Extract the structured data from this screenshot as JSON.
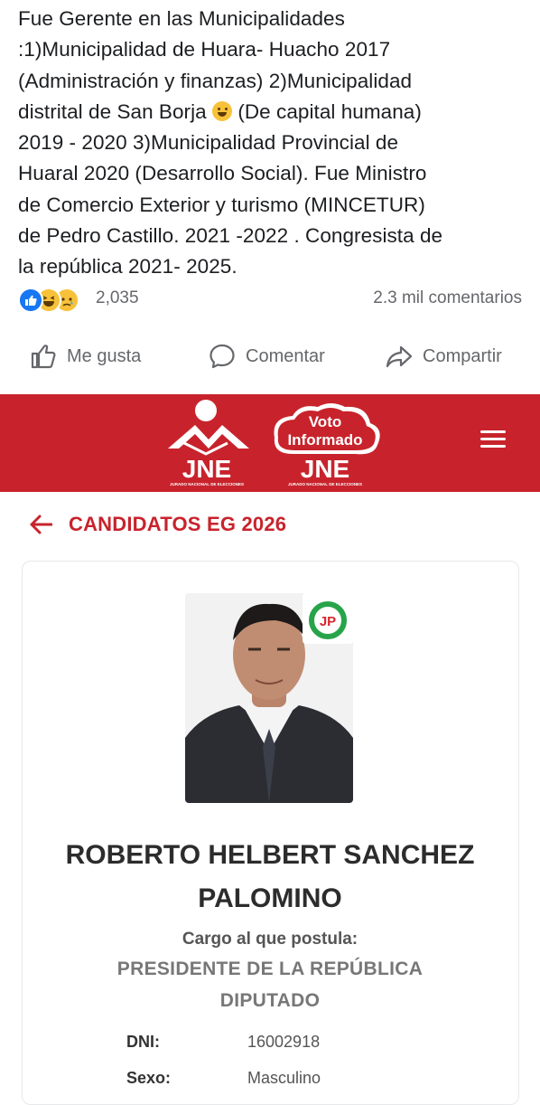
{
  "post": {
    "lines": [
      "Fue Gerente en las Municipalidades",
      ":1)Municipalidad de Huara- Huacho 2017",
      "(Administración y finanzas)  2)Municipalidad",
      "distrital de San Borja",
      " (De capital humana)",
      "2019 - 2020 3)Municipalidad Provincial de",
      "Huaral 2020 (Desarrollo Social). Fue Ministro",
      "de Comercio Exterior   y turismo (MINCETUR)",
      "de Pedro Castillo. 2021 -2022 . Congresista de",
      "la república 2021- 2025."
    ]
  },
  "reactions": {
    "count": "2,035",
    "comments": "2.3 mil comentarios",
    "icons": [
      "like-reaction",
      "haha-reaction",
      "sad-reaction"
    ]
  },
  "actions": {
    "like": "Me gusta",
    "comment": "Comentar",
    "share": "Compartir"
  },
  "jne": {
    "logo_text": "JNE",
    "logo_subtext": "JURADO NACIONAL DE ELECCIONES",
    "voto_line1": "Voto",
    "voto_line2": "Informado",
    "brand_color": "#c8232c"
  },
  "breadcrumb": {
    "title": "CANDIDATOS EG 2026"
  },
  "candidate": {
    "party_badge": "JP",
    "name_line1": "ROBERTO HELBERT SANCHEZ",
    "name_line2": "PALOMINO",
    "cargo_label": "Cargo al que postula:",
    "cargo_1": "PRESIDENTE DE LA REPÚBLICA",
    "cargo_2": "DIPUTADO",
    "dni_label": "DNI:",
    "dni_value": "16002918",
    "sexo_label": "Sexo:",
    "sexo_value": "Masculino"
  }
}
